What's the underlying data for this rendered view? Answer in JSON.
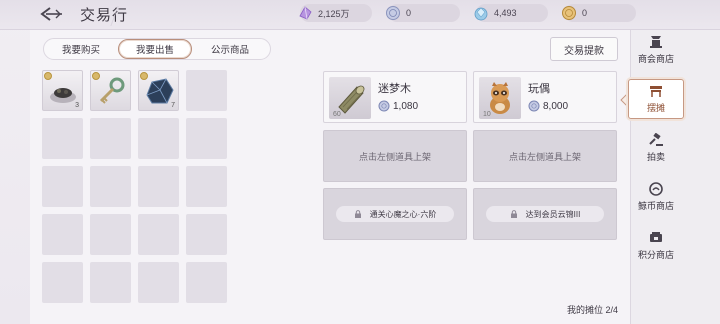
{
  "header": {
    "title": "交易行",
    "currencies": [
      {
        "icon": "crystal-icon",
        "value": "2,125万"
      },
      {
        "icon": "silver-coin-icon",
        "value": "0"
      },
      {
        "icon": "gem-pile-icon",
        "value": "4,493"
      },
      {
        "icon": "gold-coin-icon",
        "value": "0"
      }
    ]
  },
  "tabs": [
    {
      "label": "我要购买",
      "active": false
    },
    {
      "label": "我要出售",
      "active": true
    },
    {
      "label": "公示商品",
      "active": false
    }
  ],
  "withdraw_label": "交易提款",
  "inventory": [
    {
      "icon": "herb-dish-icon",
      "qty": "3"
    },
    {
      "icon": "key-icon",
      "qty": ""
    },
    {
      "icon": "ore-icon",
      "qty": "7"
    }
  ],
  "stalls": {
    "items": [
      {
        "name": "迷梦木",
        "price": "1,080",
        "level": "60",
        "icon": "wood-log-icon"
      },
      {
        "name": "玩偶",
        "price": "8,000",
        "level": "10",
        "icon": "raccoon-doll-icon"
      }
    ],
    "empty_hint": "点击左侧道具上架",
    "locks": [
      {
        "label": "通关心魔之心·六阶"
      },
      {
        "label": "达到会员云锦III"
      }
    ]
  },
  "my_stall": "我的摊位 2/4",
  "sidebar": [
    {
      "label": "商会商店",
      "icon": "guild-shop-icon",
      "active": false
    },
    {
      "label": "摆摊",
      "icon": "stall-icon",
      "active": true
    },
    {
      "label": "拍卖",
      "icon": "auction-hammer-icon",
      "active": false
    },
    {
      "label": "鲸币商店",
      "icon": "whale-coin-icon",
      "active": false
    },
    {
      "label": "积分商店",
      "icon": "points-shop-icon",
      "active": false
    }
  ],
  "colors": {
    "accent": "#c69883",
    "active_text": "#8e4f33",
    "price_coin": "#9aa6d8"
  }
}
